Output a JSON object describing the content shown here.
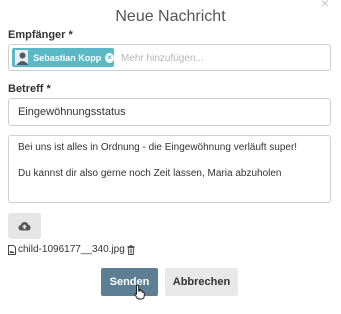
{
  "dialog": {
    "title": "Neue Nachricht",
    "close_glyph": "×"
  },
  "recipients": {
    "label": "Empfänger *",
    "chips": [
      {
        "name": "Sebastian Kopp",
        "remove_glyph": "×"
      }
    ],
    "placeholder": "Mehr hinzufügen..."
  },
  "subject": {
    "label": "Betreff *",
    "value": "Eingewöhnungsstatus"
  },
  "message": {
    "lines": [
      "Bei uns ist alles in Ordnung - die Eingewöhnung verläuft super!",
      "Du kannst dir also gerne noch Zeit lassen, Maria abzuholen"
    ]
  },
  "upload": {
    "icon": "cloud-upload-icon"
  },
  "attachments": [
    {
      "filename": "child-1096177__340.jpg",
      "icon": "image-file-icon",
      "delete_icon": "trash-icon"
    }
  ],
  "actions": {
    "send_label": "Senden",
    "cancel_label": "Abbrechen"
  },
  "colors": {
    "chip": "#5bb8c6",
    "send_button": "#5c7f94",
    "cancel_button": "#e8e8e8"
  }
}
